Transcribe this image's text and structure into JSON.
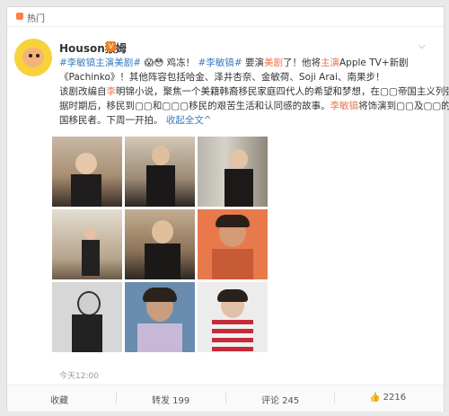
{
  "hot_label": "热门",
  "user": {
    "name": "Houson猴姆"
  },
  "post": {
    "line1_a": "#李敏镐主演美剧#",
    "line1_b": "😱😳 鸡冻！",
    "line1_c": "#李敏镐#",
    "line1_d": "要演",
    "line1_e": "美剧",
    "line1_f": "了！他将",
    "line1_g": "主演",
    "line1_h": "Apple TV+新剧",
    "line2": "《Pachinko》！其他阵容包括哈金、泽井杏奈、金敏荷、Soji Arai、南果步！",
    "line3_a": "该剧改编自",
    "line3_b": "李",
    "line3_c": "明锦小说，聚焦一个美籍韩裔移民家庭四代人的希望和梦想，在▢▢帝国主义列强占",
    "line4": "据时期后，移民到▢▢和▢▢▢移民的艰苦生活和认同感的故事。",
    "line4_hl": "李敏镐",
    "line4_b": "将饰演到▢▢及▢▢的韩",
    "line5": "国移民者。下周一开拍。",
    "line5_link": "收起全文",
    "line5_arrow": "^"
  },
  "timestamp": "今天12:00",
  "actions": {
    "favorite": "收藏",
    "repost": "转发 199",
    "comment": "评论 245",
    "like": "2216"
  },
  "colors": {
    "highlight": "#eb7350",
    "link": "#3a7cc0"
  }
}
